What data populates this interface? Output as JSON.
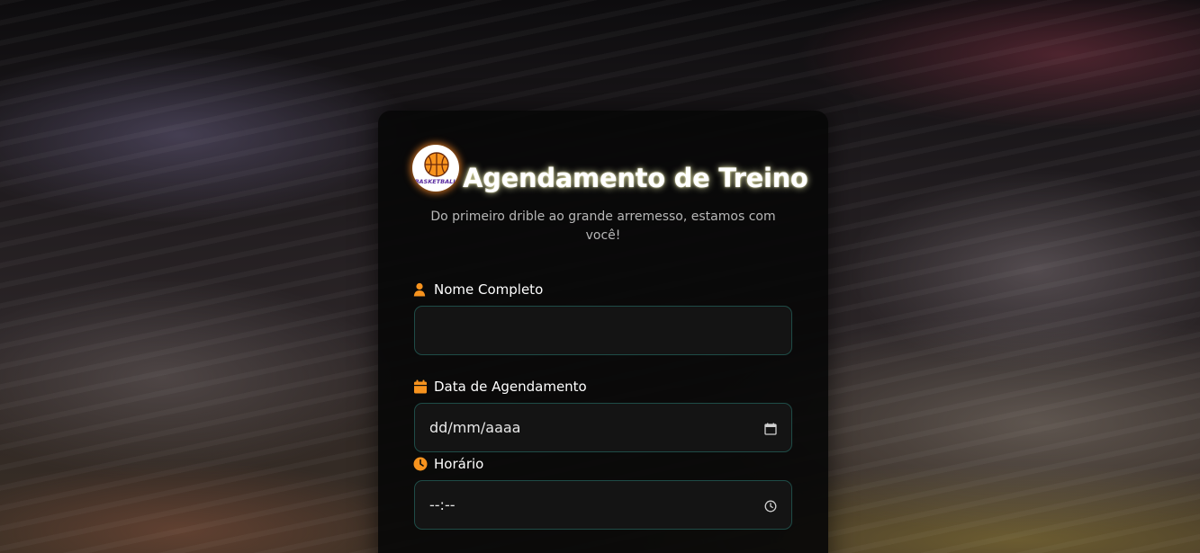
{
  "form": {
    "title": "Agendamento de Treino",
    "subtitle": "Do primeiro drible ao grande arremesso, estamos com você!",
    "logo": {
      "icon": "basketball-icon",
      "text": "BASKETBALL"
    },
    "fields": [
      {
        "label": "Nome Completo",
        "icon": "user-icon",
        "value": "",
        "type": "text"
      },
      {
        "label": "Data de Agendamento",
        "icon": "calendar-icon",
        "placeholder": "dd/mm/aaaa",
        "trailing_icon": "calendar-picker-icon",
        "type": "date"
      },
      {
        "label": "Horário",
        "icon": "clock-icon",
        "placeholder": "--:--",
        "trailing_icon": "clock-picker-icon",
        "type": "time"
      }
    ]
  },
  "colors": {
    "accent": "#f7931e",
    "input_border": "#1f4c47",
    "card_background": "#080808"
  }
}
